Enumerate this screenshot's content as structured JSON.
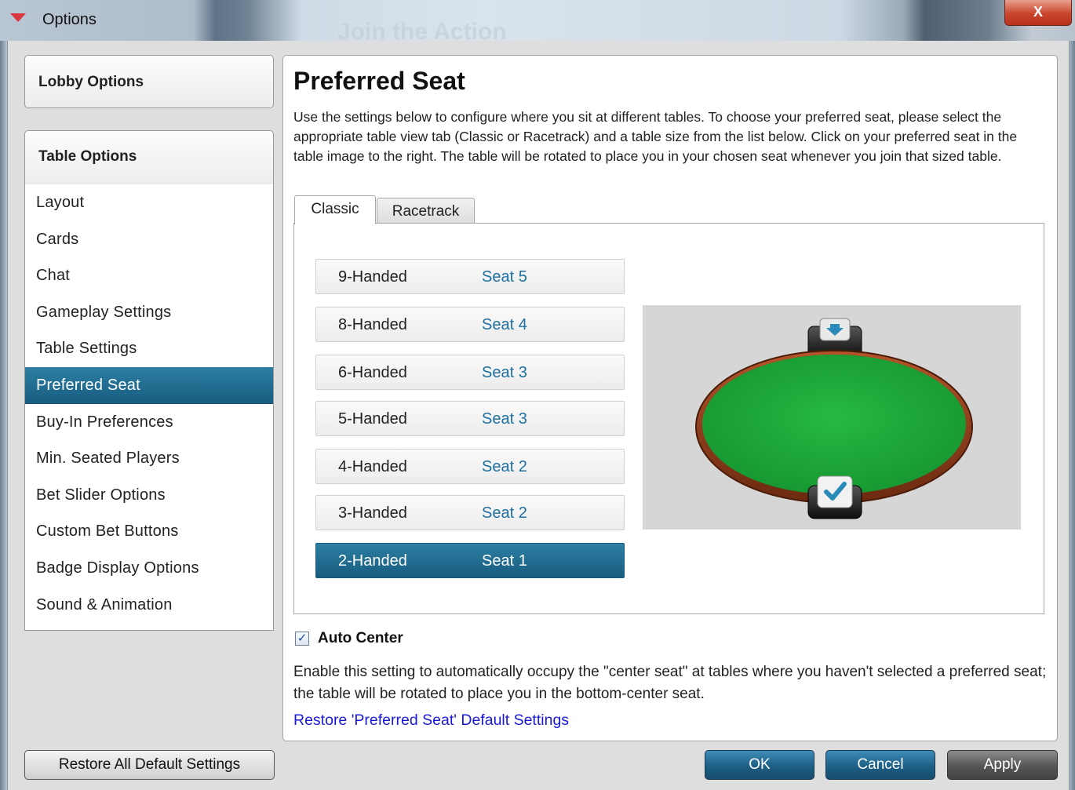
{
  "window": {
    "title": "Options",
    "watermark": "Join the Action",
    "close_label": "X"
  },
  "sidebar": {
    "lobby_label": "Lobby Options",
    "table_label": "Table Options",
    "items": [
      {
        "label": "Layout",
        "active": false
      },
      {
        "label": "Cards",
        "active": false
      },
      {
        "label": "Chat",
        "active": false
      },
      {
        "label": "Gameplay Settings",
        "active": false
      },
      {
        "label": "Table Settings",
        "active": false
      },
      {
        "label": "Preferred Seat",
        "active": true
      },
      {
        "label": "Buy-In Preferences",
        "active": false
      },
      {
        "label": "Min. Seated Players",
        "active": false
      },
      {
        "label": "Bet Slider Options",
        "active": false
      },
      {
        "label": "Custom Bet Buttons",
        "active": false
      },
      {
        "label": "Badge Display Options",
        "active": false
      },
      {
        "label": "Sound & Animation",
        "active": false
      }
    ]
  },
  "main": {
    "title": "Preferred Seat",
    "description": "Use the settings below to configure where you sit at different tables. To choose your preferred seat, please select the appropriate table view tab (Classic or Racetrack) and a table size from the list below. Click on your preferred seat in the table image to the right. The table will be rotated to place you in your chosen seat whenever you join that sized table.",
    "tabs": [
      {
        "label": "Classic",
        "active": true
      },
      {
        "label": "Racetrack",
        "active": false
      }
    ],
    "seat_rows": [
      {
        "hand": "9-Handed",
        "seat": "Seat 5",
        "active": false
      },
      {
        "hand": "8-Handed",
        "seat": "Seat 4",
        "active": false
      },
      {
        "hand": "6-Handed",
        "seat": "Seat 3",
        "active": false
      },
      {
        "hand": "5-Handed",
        "seat": "Seat 3",
        "active": false
      },
      {
        "hand": "4-Handed",
        "seat": "Seat 2",
        "active": false
      },
      {
        "hand": "3-Handed",
        "seat": "Seat 2",
        "active": false
      },
      {
        "hand": "2-Handed",
        "seat": "Seat 1",
        "active": true
      }
    ],
    "auto_center": {
      "checked": true,
      "label": "Auto Center",
      "description": "Enable this setting to automatically occupy the \"center seat\" at tables where you haven't selected a preferred seat; the table will be rotated to place you in the bottom-center seat."
    },
    "restore_link": "Restore 'Preferred Seat' Default Settings"
  },
  "footer": {
    "restore_all": "Restore All Default Settings",
    "ok": "OK",
    "cancel": "Cancel",
    "apply": "Apply"
  },
  "colors": {
    "accent": "#1e6a92",
    "felt": "#1faa3a",
    "rail": "#8a3415"
  }
}
